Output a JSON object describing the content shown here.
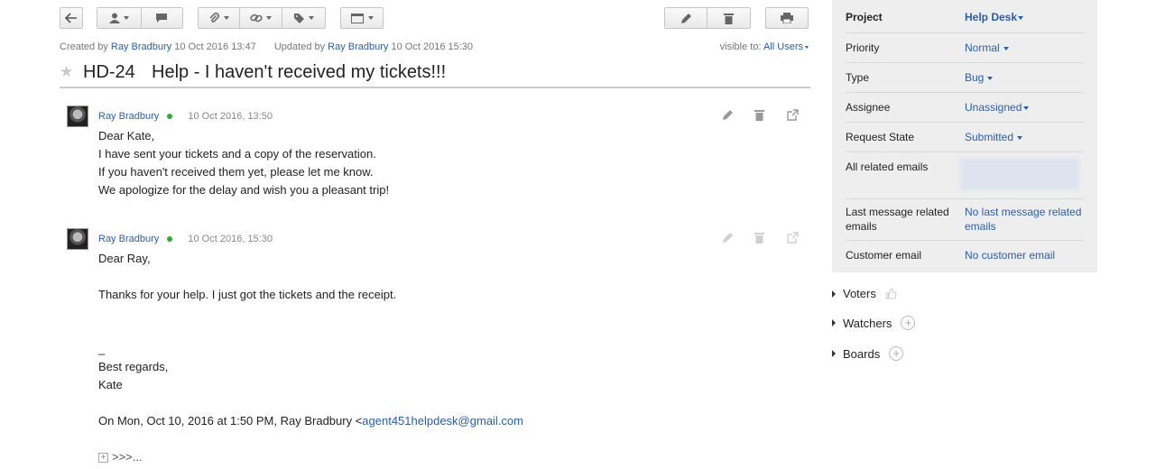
{
  "toolbar": {
    "back": "back-arrow-icon"
  },
  "meta": {
    "created_by_label": "Created by",
    "created_by": "Ray Bradbury",
    "created_at": "10 Oct 2016 13:47",
    "updated_by_label": "Updated by",
    "updated_by": "Ray Bradbury",
    "updated_at": "10 Oct 2016 15:30",
    "visible_label": "visible to:",
    "visible_value": "All Users"
  },
  "issue": {
    "id": "HD-24",
    "title": "Help - I haven't received my tickets!!!"
  },
  "messages": [
    {
      "author": "Ray Bradbury",
      "date": "10 Oct 2016, 13:50",
      "lines": [
        "Dear Kate,",
        "I have sent your tickets and a copy of the reservation.",
        "If you haven't received them yet, please let me know.",
        "We apologize for the delay and wish you a pleasant trip!"
      ]
    },
    {
      "author": "Ray Bradbury",
      "date": "10 Oct 2016, 15:30",
      "lines": [
        "Dear Ray,",
        "Thanks for your help. I just got the tickets and the receipt.",
        "_",
        "Best regards,",
        "Kate",
        "On Mon, Oct 10, 2016 at 1:50 PM, Ray Bradbury <"
      ],
      "email_link": "agent451helpdesk@gmail.com",
      "expand": ">>>..."
    }
  ],
  "fields": {
    "project": {
      "label": "Project",
      "value": "Help Desk"
    },
    "priority": {
      "label": "Priority",
      "value": "Normal"
    },
    "type": {
      "label": "Type",
      "value": "Bug"
    },
    "assignee": {
      "label": "Assignee",
      "value": "Unassigned"
    },
    "state": {
      "label": "Request State",
      "value": "Submitted"
    },
    "related": {
      "label": "All related emails"
    },
    "last_msg": {
      "label": "Last message related emails",
      "value": "No last message related emails"
    },
    "customer": {
      "label": "Customer email",
      "value": "No customer email"
    }
  },
  "sections": {
    "voters": "Voters",
    "watchers": "Watchers",
    "boards": "Boards"
  },
  "colors": {
    "link": "#2a5db0",
    "online": "#2cb02c",
    "panel": "#eeeeee"
  }
}
